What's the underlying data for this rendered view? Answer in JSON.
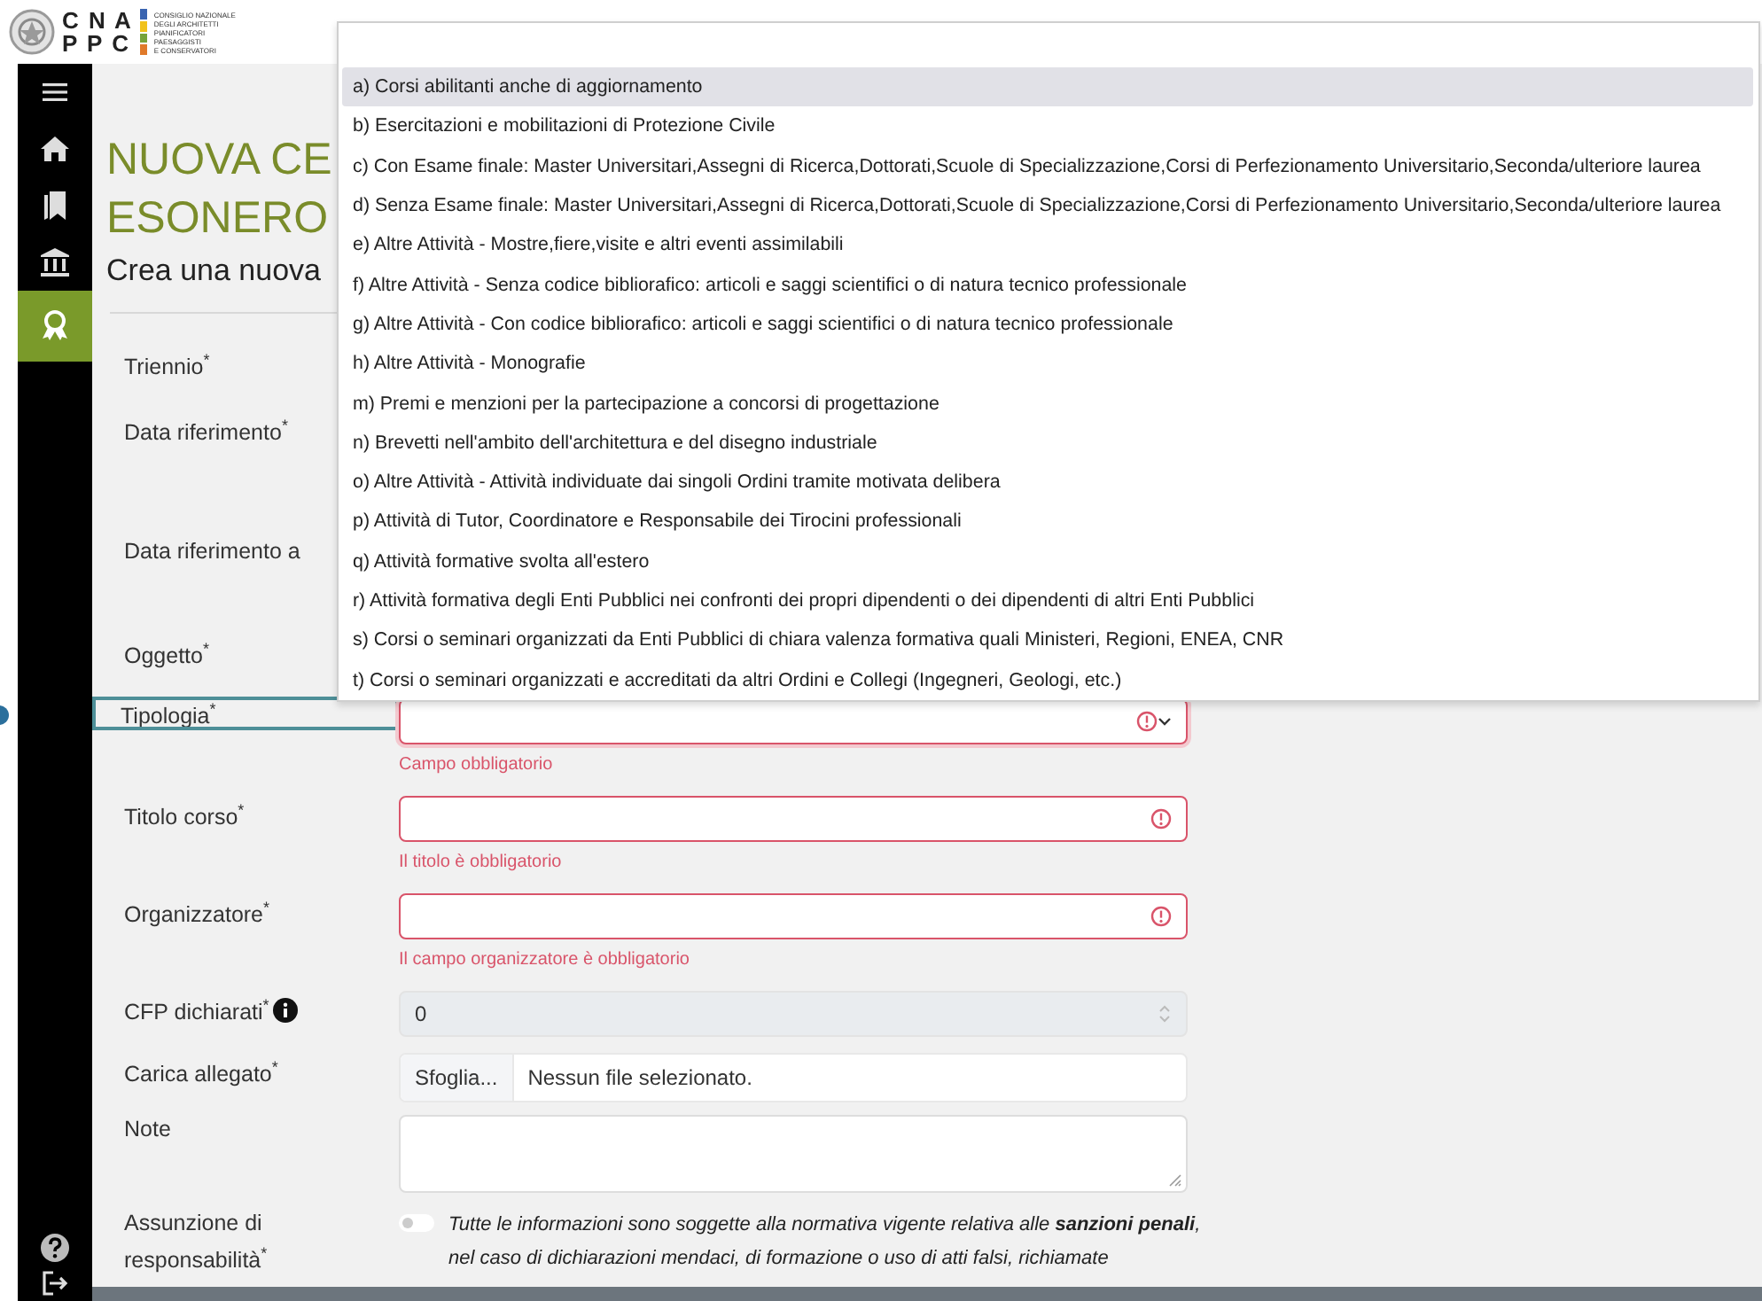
{
  "header": {
    "logo": {
      "letters_top": "C N A",
      "letters_bottom": "P P C",
      "lines": [
        "CONSIGLIO NAZIONALE",
        "DEGLI ARCHITETTI",
        "PIANIFICATORI",
        "PAESAGGISTI",
        "E CONSERVATORI"
      ]
    }
  },
  "sidebar": {
    "items": [
      {
        "selected": false
      },
      {
        "selected": false
      },
      {
        "selected": false
      },
      {
        "selected": false
      },
      {
        "selected": true
      }
    ],
    "bottom_items": [
      {
        "selected": false
      },
      {
        "selected": false
      }
    ]
  },
  "page": {
    "title_lines": [
      "NUOVA CE",
      "ESONERO"
    ],
    "subtitle": "Crea una nuova"
  },
  "form": {
    "fields": [
      {
        "label": "Triennio$^{*}$",
        "kind": "covered",
        "focused": false
      },
      {
        "label": "Data riferimento$^{*}$",
        "kind": "covered",
        "focused": false
      },
      {
        "label": "Data riferimento a",
        "kind": "covered",
        "focused": false
      },
      {
        "label": "Oggetto$^{*}$",
        "kind": "covered",
        "focused": false
      },
      {
        "label": "Tipologia$^{*}$",
        "kind": "select",
        "focused": true,
        "invalid": true,
        "error": "Campo obbligatorio"
      },
      {
        "label": "Titolo corso$^{*}$",
        "kind": "text",
        "focused": false,
        "invalid": true,
        "error": "Il titolo è obbligatorio"
      },
      {
        "label": "Organizzatore$^{*}$",
        "kind": "text",
        "focused": false,
        "invalid": true,
        "error": "Il campo organizzatore è obbligatorio"
      },
      {
        "label": "CFP dichiarati$^{*}$",
        "kind": "number",
        "focused": false,
        "info": true,
        "disabled": true,
        "value": "0"
      },
      {
        "label": "Carica allegato$^{*}$",
        "kind": "file",
        "focused": false,
        "button": "Sfoglia...",
        "value": "Nessun file selezionato."
      },
      {
        "label": "Note",
        "kind": "textarea",
        "focused": false
      },
      {
        "label": "Assunzione di responsabilità$^{*}$",
        "kind": "toggle",
        "focused": false,
        "on": false,
        "text": "Tutte le informazioni sono soggette alla normativa vigente relativa alle **sanzioni penali**, nel caso di dichiarazioni mendaci, di formazione o uso di atti falsi, richiamate"
      }
    ]
  },
  "dropdown": {
    "options": [
      {
        "label": "a) Corsi abilitanti anche di aggiornamento",
        "selected": true
      },
      {
        "label": "b) Esercitazioni e mobilitazioni di Protezione Civile",
        "selected": false
      },
      {
        "label": "c) Con Esame finale: Master Universitari,Assegni di Ricerca,Dottorati,Scuole di Specializzazione,Corsi di Perfezionamento Universitario,Seconda/ulteriore laurea",
        "selected": false
      },
      {
        "label": "d) Senza Esame finale: Master Universitari,Assegni di Ricerca,Dottorati,Scuole di Specializzazione,Corsi di Perfezionamento Universitario,Seconda/ulteriore laurea",
        "selected": false
      },
      {
        "label": "e) Altre Attività - Mostre,fiere,visite e altri eventi assimilabili",
        "selected": false
      },
      {
        "label": "f) Altre Attività - Senza codice bibliorafico: articoli e saggi scientifici o di natura tecnico professionale",
        "selected": false
      },
      {
        "label": "g) Altre Attività - Con codice bibliorafico: articoli e saggi scientifici o di natura tecnico professionale",
        "selected": false
      },
      {
        "label": "h) Altre Attività - Monografie",
        "selected": false
      },
      {
        "label": "m) Premi e menzioni per la partecipazione a concorsi di progettazione",
        "selected": false
      },
      {
        "label": "n) Brevetti nell'ambito dell'architettura e del disegno industriale",
        "selected": false
      },
      {
        "label": "o) Altre Attività - Attività individuate dai singoli Ordini tramite motivata delibera",
        "selected": false
      },
      {
        "label": "p) Attività di Tutor, Coordinatore e Responsabile dei Tirocini professionali",
        "selected": false
      },
      {
        "label": "q) Attività formative svolta all'estero",
        "selected": false
      },
      {
        "label": "r) Attività formativa degli Enti Pubblici nei confronti dei propri dipendenti o dei dipendenti di altri Enti Pubblici",
        "selected": false
      },
      {
        "label": "s) Corsi o seminari organizzati da Enti Pubblici di chiara valenza formativa quali Ministeri, Regioni, ENEA, CNR",
        "selected": false
      },
      {
        "label": "t) Corsi o seminari organizzati e accreditati da altri Ordini e Collegi (Ingegneri, Geologi, etc.)",
        "selected": false
      }
    ]
  }
}
